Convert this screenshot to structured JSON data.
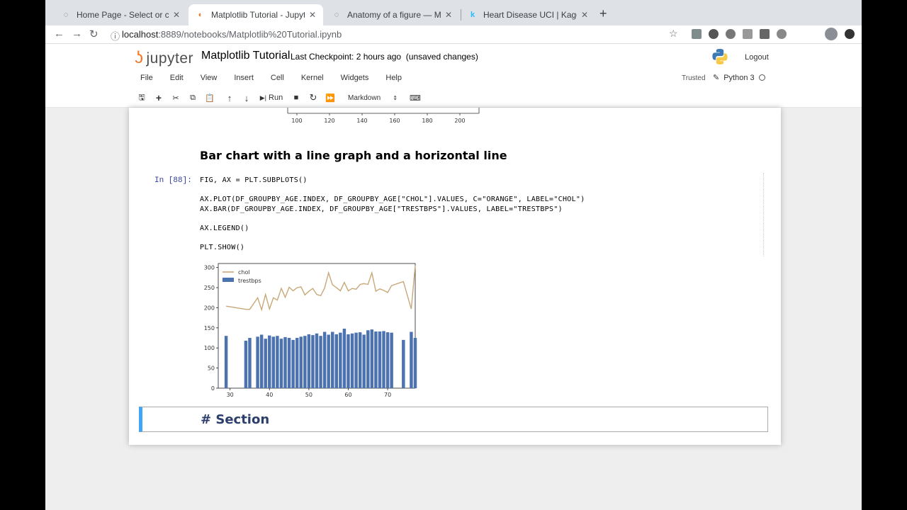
{
  "browser": {
    "tabs": [
      {
        "title": "Home Page - Select or create",
        "favicon": "loading-icon",
        "active": false
      },
      {
        "title": "Matplotlib Tutorial - Jupyter N",
        "favicon": "jupyter-icon",
        "active": true
      },
      {
        "title": "Anatomy of a figure — Matplo",
        "favicon": "page-icon",
        "active": false
      },
      {
        "title": "Heart Disease UCI | Kaggle",
        "favicon": "kaggle-icon",
        "active": false
      }
    ],
    "url_host": "localhost",
    "url_rest": ":8889/notebooks/Matplotlib%20Tutorial.ipynb"
  },
  "jupyter": {
    "logo_text": "jupyter",
    "notebook_title": "Matplotlib Tutorial",
    "checkpoint": "Last Checkpoint: 2 hours ago",
    "unsaved": "(unsaved changes)",
    "logout": "Logout",
    "menu": [
      "File",
      "Edit",
      "View",
      "Insert",
      "Cell",
      "Kernel",
      "Widgets",
      "Help"
    ],
    "trusted": "Trusted",
    "kernel": "Python 3",
    "toolbar": {
      "run_label": "Run",
      "cell_type": "Markdown"
    }
  },
  "notebook": {
    "prev_axis_ticks": [
      "100",
      "120",
      "140",
      "160",
      "180",
      "200"
    ],
    "markdown_heading": "Bar chart with a line graph and a horizontal line",
    "prompt": "In [88]:",
    "code_lines": [
      "FIG, AX = PLT.SUBPLOTS()",
      "",
      "AX.PLOT(DF_GROUPBY_AGE.INDEX, DF_GROUPBY_AGE[\"CHOL\"].VALUES, C=\"ORANGE\", LABEL=\"CHOL\")",
      "AX.BAR(DF_GROUPBY_AGE.INDEX, DF_GROUPBY_AGE[\"TRESTBPS\"].VALUES, LABEL=\"TRESTBPS\")",
      "",
      "AX.LEGEND()",
      "",
      "PLT.SHOW()"
    ],
    "section_cell": "# Section"
  },
  "chart_data": {
    "type": "bar",
    "xlim": [
      27,
      77
    ],
    "ylim": [
      0,
      310
    ],
    "xticks": [
      30,
      40,
      50,
      60,
      70
    ],
    "yticks": [
      0,
      50,
      100,
      150,
      200,
      250,
      300
    ],
    "legend_position": "top-left",
    "series": [
      {
        "name": "chol",
        "kind": "line",
        "color": "#c8a878",
        "x": [
          29,
          34,
          35,
          37,
          38,
          39,
          40,
          41,
          42,
          43,
          44,
          45,
          46,
          47,
          48,
          49,
          50,
          51,
          52,
          53,
          54,
          55,
          56,
          57,
          58,
          59,
          60,
          61,
          62,
          63,
          64,
          65,
          66,
          67,
          68,
          69,
          70,
          71,
          74,
          76,
          77
        ],
        "values": [
          204,
          196,
          196,
          225,
          195,
          233,
          197,
          225,
          219,
          248,
          226,
          251,
          242,
          250,
          252,
          232,
          241,
          248,
          233,
          230,
          249,
          287,
          257,
          250,
          242,
          263,
          242,
          248,
          246,
          258,
          260,
          258,
          287,
          241,
          247,
          243,
          238,
          255,
          265,
          197,
          305
        ]
      },
      {
        "name": "trestbps",
        "kind": "bar",
        "color": "#4c72b0",
        "x": [
          29,
          34,
          35,
          37,
          38,
          39,
          40,
          41,
          42,
          43,
          44,
          45,
          46,
          47,
          48,
          49,
          50,
          51,
          52,
          53,
          54,
          55,
          56,
          57,
          58,
          59,
          60,
          61,
          62,
          63,
          64,
          65,
          66,
          67,
          68,
          69,
          70,
          71,
          74,
          76,
          77
        ],
        "values": [
          130,
          118,
          125,
          128,
          133,
          123,
          131,
          128,
          130,
          123,
          127,
          125,
          120,
          125,
          128,
          130,
          134,
          132,
          136,
          130,
          140,
          133,
          140,
          134,
          138,
          148,
          134,
          136,
          138,
          139,
          133,
          144,
          146,
          141,
          141,
          142,
          139,
          138,
          120,
          140,
          125
        ]
      }
    ]
  }
}
